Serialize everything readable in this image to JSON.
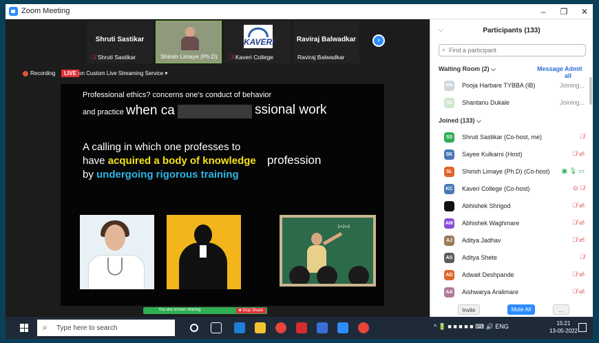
{
  "window": {
    "title": "Zoom Meeting",
    "minimize": "–",
    "restore": "❐",
    "close": "✕"
  },
  "thumbnails": [
    {
      "big_name": "Shruti Sastikar",
      "small_name": "Shruti Sastikar"
    },
    {
      "big_name": "",
      "small_name": "Shirish Limaye (Ph.D)"
    },
    {
      "big_name": "",
      "small_name": "Kaveri College"
    },
    {
      "big_name": "Raviraj Balwadkar",
      "small_name": "Raviraj Balwadkar"
    }
  ],
  "logo_word": "KAVERI",
  "recording": {
    "label": "Recording",
    "live": "LIVE",
    "stream": "on Custom Live Streaming Service ▾"
  },
  "slide": {
    "line1": "Professional ethics? concerns one's conduct of behavior",
    "line2_small": "and practice",
    "line2_big": "when ca",
    "line2_end": "ssional work",
    "para_a": "A calling in which one professes to have ",
    "para_y": "acquired a body of knowledge",
    "para_b_pre": " by ",
    "para_b": "undergoing rigorous training",
    "prof_word": "profession",
    "chalk": "1+2=3"
  },
  "share_bar": {
    "text": "You are screen sharing",
    "stop": "■ Stop Share"
  },
  "panel": {
    "title": "Participants (133)",
    "search_placeholder": "Find a participant",
    "waiting_label": "Waiting Room (2)  ⌵",
    "message": "Message",
    "admit_all": "Admit all",
    "joined_label": "Joined (133)  ⌵",
    "waiting": [
      {
        "initials": "PH",
        "name": "Pooja Harbare TYBBA (IB)",
        "status": "Joining...",
        "color": "#cfd6dc"
      },
      {
        "initials": "SD",
        "name": "Shantanu Dukale",
        "status": "Joining...",
        "color": "#cfe7d0"
      }
    ],
    "joined": [
      {
        "initials": "SS",
        "name": "Shruti Sastikar (Co-host, me)",
        "icons": "🎙̸",
        "color": "#2fae53"
      },
      {
        "initials": "SK",
        "name": "Sayee Kulkarni (Host)",
        "icons": "🎙̸ ▭̸",
        "color": "#4a78b8"
      },
      {
        "initials": "SL",
        "name": "Shirish Limaye (Ph.D) (Co-host)",
        "icons": "▣ 🎙 ▭",
        "color": "#e0642c"
      },
      {
        "initials": "KC",
        "name": "Kaveri College (Co-host)",
        "icons": "⊙ 🎙̸",
        "color": "#4a78b8"
      },
      {
        "initials": "",
        "name": "Abhishek Shrigod",
        "icons": "🎙̸ ▭̸",
        "color": "#111111"
      },
      {
        "initials": "AW",
        "name": "Abhishek Waghmare",
        "icons": "🎙̸ ▭̸",
        "color": "#8a4fd6"
      },
      {
        "initials": "AJ",
        "name": "Aditya Jadhav",
        "icons": "🎙̸ ▭̸",
        "color": "#9a7b5c"
      },
      {
        "initials": "AS",
        "name": "Aditya Shete",
        "icons": "🎙̸",
        "color": "#5b5b5b"
      },
      {
        "initials": "AD",
        "name": "Adwait Deshpande",
        "icons": "🎙̸ ▭̸",
        "color": "#e0642c"
      },
      {
        "initials": "AA",
        "name": "Aishwarya Aralimare",
        "icons": "🎙̸ ▭̸",
        "color": "#b07a9a"
      }
    ],
    "invite": "Invite",
    "mute_all": "Mute All",
    "more": "..."
  },
  "taskbar": {
    "search_placeholder": "Type here to search",
    "tray": "^ 🔋 ■ ■ ■ ■ ■ ⌨ 🔊 ENG",
    "time": "15:21",
    "date": "13-05-2022"
  }
}
